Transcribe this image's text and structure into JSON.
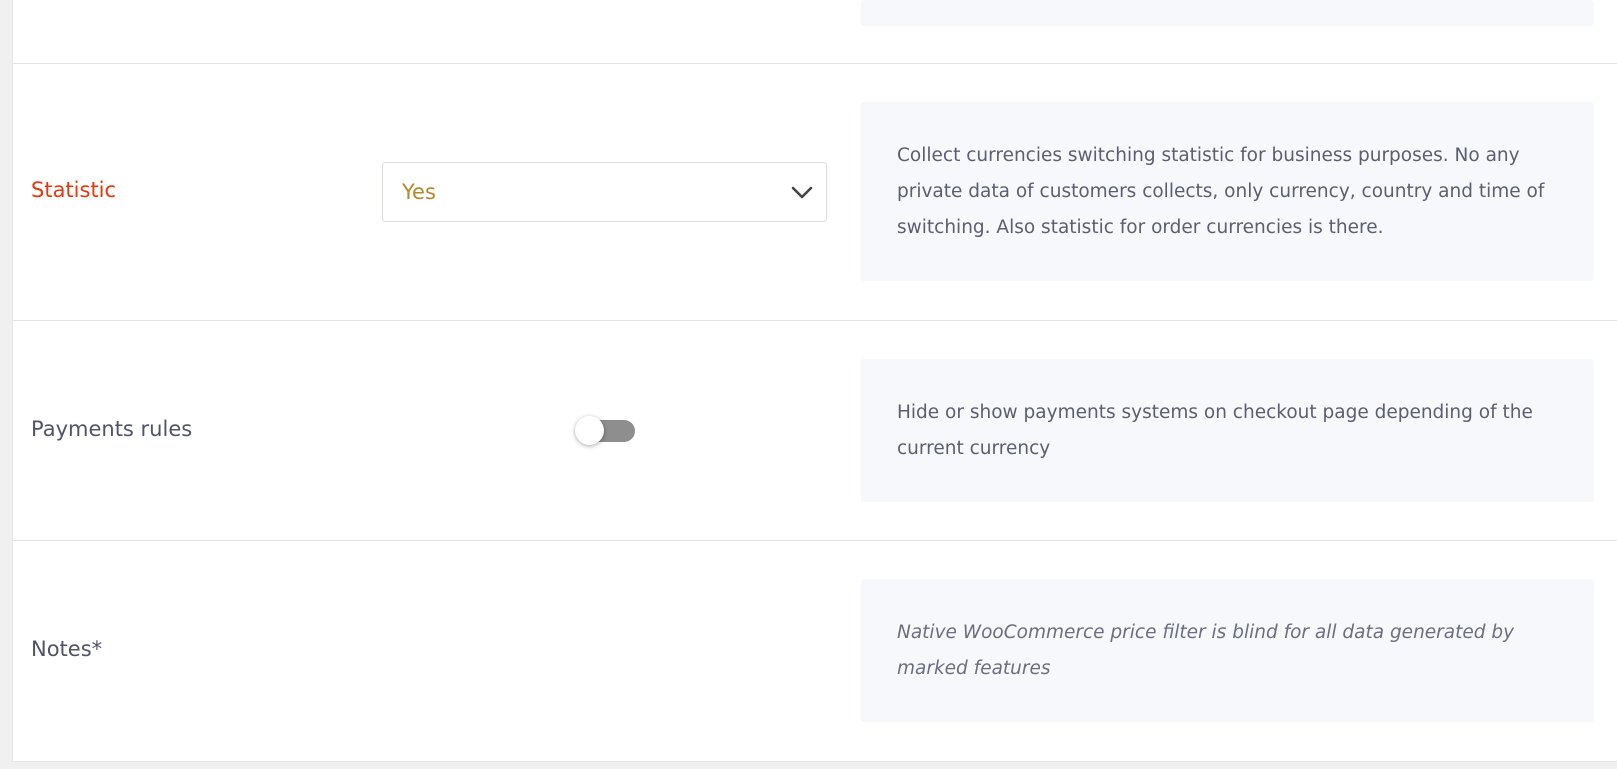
{
  "settings": {
    "statistic": {
      "label": "Statistic",
      "selected_value": "Yes",
      "description": "Collect currencies switching statistic for business purposes. No any private data of customers collects, only currency, country and time of switching. Also statistic for order currencies is there."
    },
    "payments_rules": {
      "label": "Payments rules",
      "enabled": false,
      "description": "Hide or show payments systems on checkout page depending of the current currency"
    },
    "notes": {
      "label": "Notes*",
      "description": "Native WooCommerce price filter is blind for all data generated by marked features"
    }
  },
  "colors": {
    "highlight_label": "#e8370d",
    "select_value": "#b6862a",
    "toggle_off": "#8e8e8e",
    "description_bg": "#f7f8fb"
  },
  "icons": {
    "select_arrow": "chevron-down-icon"
  }
}
